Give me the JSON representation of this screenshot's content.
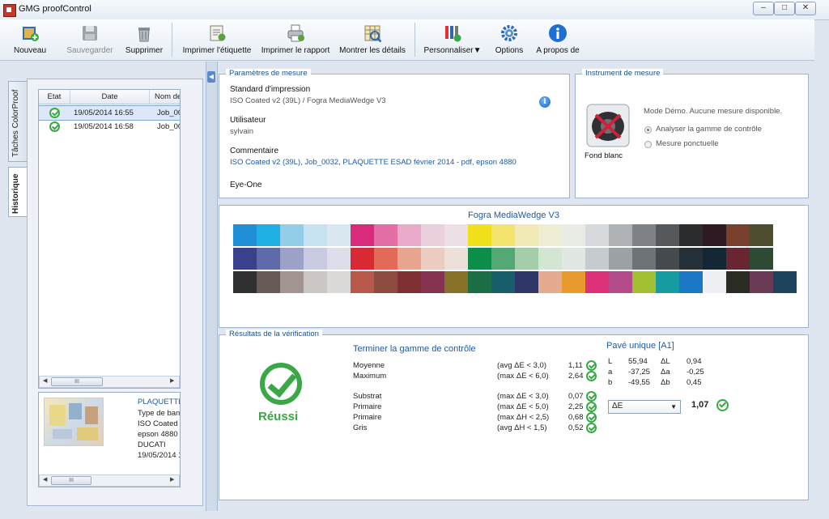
{
  "window": {
    "title": "GMG proofControl",
    "controls": [
      "–",
      "□",
      "✕"
    ]
  },
  "toolbar": {
    "nouveau": "Nouveau",
    "sauvegarder": "Sauvegarder",
    "supprimer": "Supprimer",
    "imprimer_etiquette": "Imprimer l'étiquette",
    "imprimer_rapport": "Imprimer le rapport",
    "montrer_details": "Montrer les détails",
    "personnaliser": "Personnaliser",
    "options": "Options",
    "a_propos": "A propos de"
  },
  "sidebar": {
    "tabs": [
      "Tâches ColorProof",
      "Historique"
    ]
  },
  "history": {
    "columns": [
      "Etat",
      "Date",
      "Nom de"
    ],
    "rows": [
      {
        "status": "ok",
        "date": "19/05/2014 16:55",
        "name": "Job_00"
      },
      {
        "status": "ok",
        "date": "19/05/2014 16:58",
        "name": "Job_00"
      }
    ],
    "scroll_grip": "III",
    "preview": {
      "lines": [
        "PLAQUETTE",
        "Type de banc",
        "ISO Coated v",
        "epson 4880",
        "DUCATI",
        "19/05/2014 1"
      ]
    }
  },
  "params": {
    "title": "Paramètres de mesure",
    "standard_label": "Standard d'impression",
    "standard_value": "ISO Coated v2 (39L) / Fogra MediaWedge V3",
    "user_label": "Utilisateur",
    "user_value": "sylvain",
    "comment_label": "Commentaire",
    "comment_value": "ISO Coated v2 (39L),  Job_0032, PLAQUETTE ESAD  février 2014 - pdf, epson 4880",
    "device": "Eye-One",
    "info_glyph": "i"
  },
  "instrument": {
    "title": "Instrument de mesure",
    "demo_text": "Mode Démo. Aucune mesure disponible.",
    "option_range": "Analyser la gamme de contrôle",
    "option_spot": "Mesure ponctuelle",
    "caption": "Fond blanc",
    "selected_option": "range"
  },
  "wedge": {
    "title": "Fogra MediaWedge V3",
    "rows": [
      [
        "#1f8fd8",
        "#1fb1e4",
        "#93cdea",
        "#c7e3f2",
        "#d9e8f1",
        "#d92a7d",
        "#e46fa6",
        "#e9a9c9",
        "#ead0dd",
        "#ece0e6",
        "#f1e11b",
        "#f2e46d",
        "#f1eab6",
        "#efeed5",
        "#e8ece5",
        "#d6dadd",
        "#b0b3b6",
        "#7f8387",
        "#56595c",
        "#2b2c2e",
        "#2e1a22",
        "#79402d",
        "#4f4d2f"
      ],
      [
        "#39418d",
        "#5f6aa9",
        "#9da1c8",
        "#c9cbe1",
        "#dddeea",
        "#d72a32",
        "#e26b57",
        "#e7a58f",
        "#ecccc1",
        "#ede0da",
        "#0d8d48",
        "#55a774",
        "#a4cdaa",
        "#d3e5d3",
        "#e0e8e1",
        "#c6cbd0",
        "#9ca1a6",
        "#6e7378",
        "#454a4f",
        "#263039",
        "#132834",
        "#6a2533",
        "#2d4a34"
      ],
      [
        "#303032",
        "#675a57",
        "#a29592",
        "#ccc6c4",
        "#dcdad9",
        "#b7584a",
        "#8c4b3e",
        "#802f33",
        "#84324f",
        "#877126",
        "#1b6d45",
        "#185f6b",
        "#2f3768",
        "#e5ab8f",
        "#e99a2d",
        "#de3278",
        "#b44b8b",
        "#a3c032",
        "#169ba1",
        "#1c78c4",
        "#eff0f3",
        "#2a2b22",
        "#6b3a55",
        "#1e435c"
      ]
    ]
  },
  "results": {
    "title": "Résultats de la vérification",
    "status": "Réussi",
    "heading": "Terminer la gamme de contrôle",
    "lines": [
      {
        "label": "Moyenne",
        "criteria": "(avg  ΔE < 3,0)",
        "value": "1,11"
      },
      {
        "label": "Maximum",
        "criteria": "(max ΔE < 6,0)",
        "value": "2,64"
      },
      {
        "label": "Substrat",
        "criteria": "(max ΔE < 3,0)",
        "value": "0,07"
      },
      {
        "label": "Primaire",
        "criteria": "(max ΔE < 5,0)",
        "value": "2,25"
      },
      {
        "label": "Primaire",
        "criteria": "(max ΔH < 2,5)",
        "value": "0,68"
      },
      {
        "label": "Gris",
        "criteria": "(avg ΔH < 1,5)",
        "value": "0,52"
      }
    ],
    "single": {
      "title": "Pavé unique [A1]",
      "values": [
        {
          "a": "L",
          "av": "55,94",
          "b": "ΔL",
          "bv": "0,94"
        },
        {
          "a": "a",
          "av": "-37,25",
          "b": "Δa",
          "bv": "-0,25"
        },
        {
          "a": "b",
          "av": "-49,55",
          "b": "Δb",
          "bv": "0,45"
        }
      ],
      "metric": "ΔE",
      "metric_value": "1,07"
    }
  },
  "colors": {
    "accent": "#1f5aa6",
    "ok": "#3aa845"
  }
}
